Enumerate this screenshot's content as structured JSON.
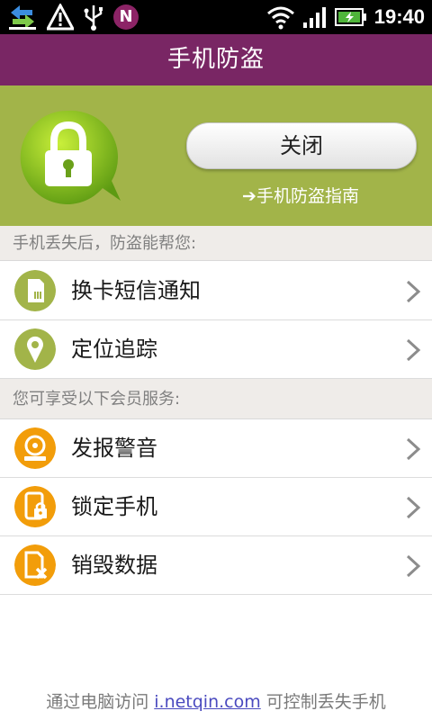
{
  "status_bar": {
    "time": "19:40",
    "notification_badge": "N",
    "icons": [
      "sync-icon",
      "warning-icon",
      "usb-icon",
      "netqin-icon",
      "wifi-icon",
      "signal-icon",
      "battery-icon"
    ]
  },
  "header": {
    "title": "手机防盗"
  },
  "hero": {
    "close_button": "关闭",
    "guide_link": "➔手机防盗指南",
    "accent_color": "#a2b449"
  },
  "section1": {
    "title": "手机丢失后，防盗能帮您:",
    "items": [
      {
        "label": "换卡短信通知",
        "icon": "sim-card-icon"
      },
      {
        "label": "定位追踪",
        "icon": "location-pin-icon"
      }
    ]
  },
  "section2": {
    "title": "您可享受以下会员服务:",
    "items": [
      {
        "label": "发报警音",
        "icon": "alarm-bell-icon"
      },
      {
        "label": "锁定手机",
        "icon": "phone-lock-icon"
      },
      {
        "label": "销毁数据",
        "icon": "delete-data-icon"
      }
    ]
  },
  "footer": {
    "prefix": "通过电脑访问 ",
    "link": "i.netqin.com",
    "suffix": " 可控制丢失手机"
  },
  "colors": {
    "titlebar": "#792664",
    "green_icon": "#a2b449",
    "orange_icon": "#f29d0a"
  }
}
